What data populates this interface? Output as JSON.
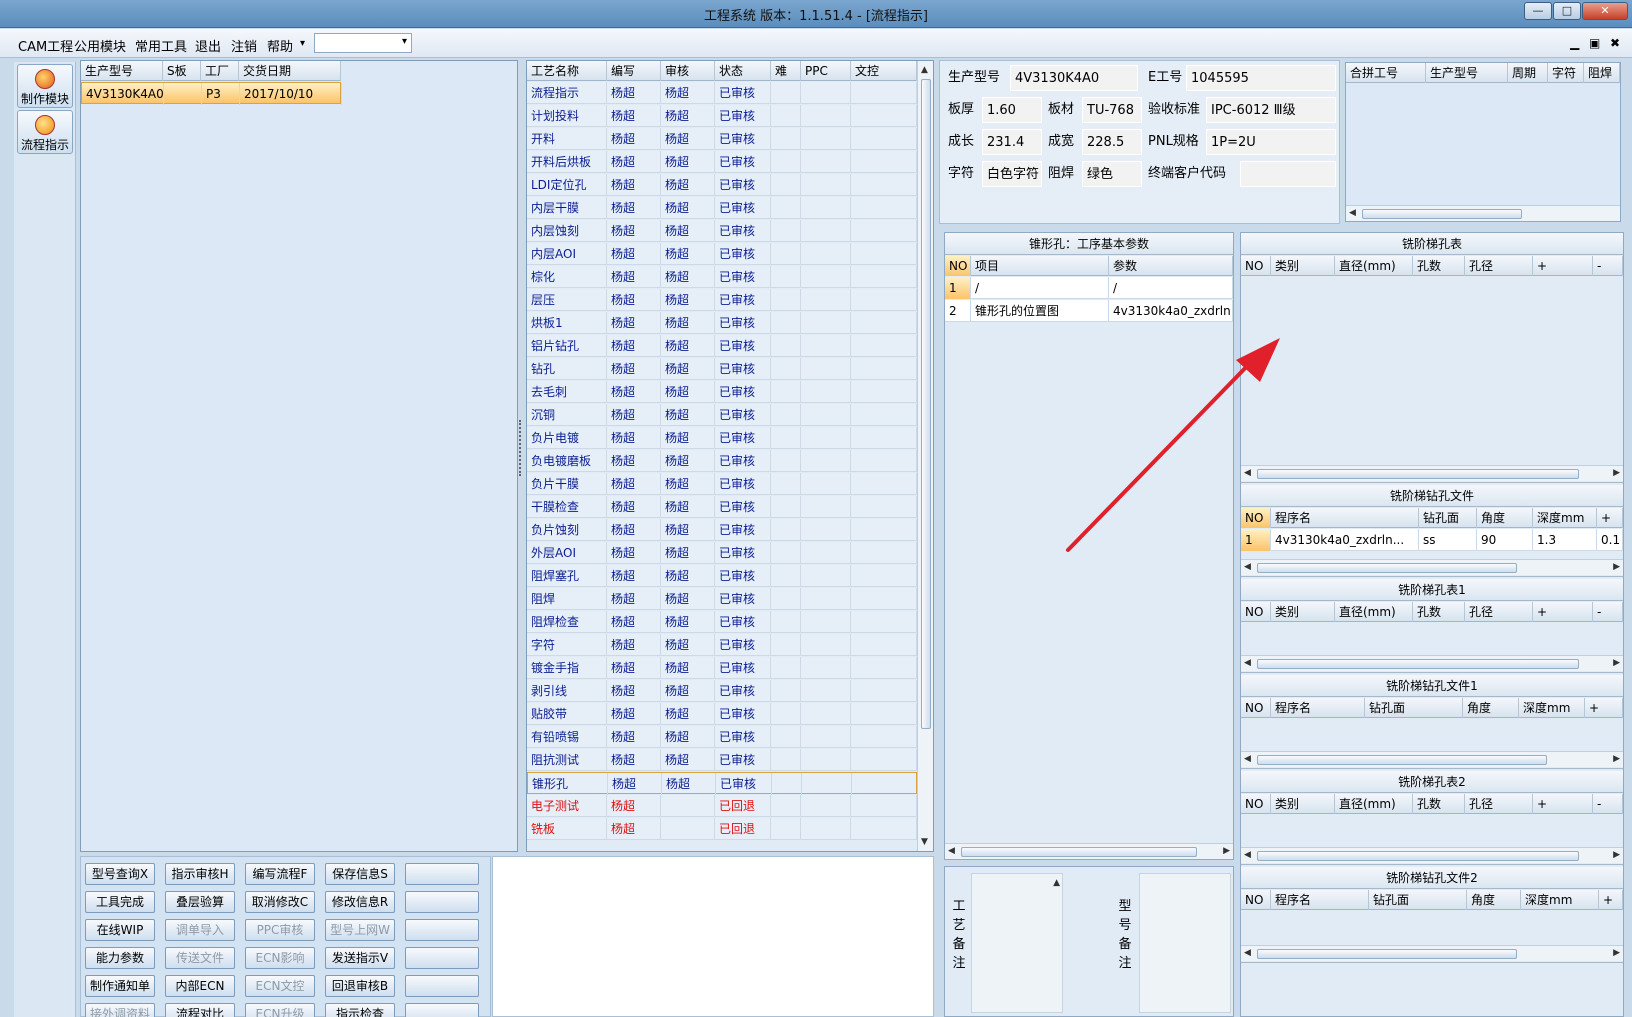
{
  "window": {
    "title": "工程系统   版本：1.1.51.4 - [流程指示]",
    "controls": {
      "minimize": "—",
      "maximize": "□",
      "close": "✕"
    }
  },
  "menu": {
    "items": [
      "CAM工程",
      "公用模块",
      "常用工具",
      "退出",
      "注销",
      "帮助"
    ],
    "dropdown_caret": "▾",
    "mdi": {
      "minimize": "▁",
      "restore": "▣",
      "close": "✖"
    }
  },
  "sidenav": {
    "items": [
      {
        "label": "制作模块",
        "icon": "flame-icon"
      },
      {
        "label": "流程指示",
        "icon": "pause-icon"
      }
    ]
  },
  "product_grid": {
    "headers": [
      "生产型号",
      "S板",
      "工厂",
      "交货日期"
    ],
    "rows": [
      [
        "4V3130K4A0",
        "",
        "P3",
        "2017/10/10"
      ]
    ]
  },
  "process_grid": {
    "headers": [
      "工艺名称",
      "编写",
      "审核",
      "状态",
      "难",
      "PPC",
      "文控"
    ],
    "rows": [
      [
        "流程指示",
        "杨超",
        "杨超",
        "已审核"
      ],
      [
        "计划投料",
        "杨超",
        "杨超",
        "已审核"
      ],
      [
        "开料",
        "杨超",
        "杨超",
        "已审核"
      ],
      [
        "开料后烘板",
        "杨超",
        "杨超",
        "已审核"
      ],
      [
        "LDI定位孔",
        "杨超",
        "杨超",
        "已审核"
      ],
      [
        "内层干膜",
        "杨超",
        "杨超",
        "已审核"
      ],
      [
        "内层蚀刻",
        "杨超",
        "杨超",
        "已审核"
      ],
      [
        "内层AOI",
        "杨超",
        "杨超",
        "已审核"
      ],
      [
        "棕化",
        "杨超",
        "杨超",
        "已审核"
      ],
      [
        "层压",
        "杨超",
        "杨超",
        "已审核"
      ],
      [
        "烘板1",
        "杨超",
        "杨超",
        "已审核"
      ],
      [
        "铝片钻孔",
        "杨超",
        "杨超",
        "已审核"
      ],
      [
        "钻孔",
        "杨超",
        "杨超",
        "已审核"
      ],
      [
        "去毛刺",
        "杨超",
        "杨超",
        "已审核"
      ],
      [
        "沉铜",
        "杨超",
        "杨超",
        "已审核"
      ],
      [
        "负片电镀",
        "杨超",
        "杨超",
        "已审核"
      ],
      [
        "负电镀磨板",
        "杨超",
        "杨超",
        "已审核"
      ],
      [
        "负片干膜",
        "杨超",
        "杨超",
        "已审核"
      ],
      [
        "干膜检查",
        "杨超",
        "杨超",
        "已审核"
      ],
      [
        "负片蚀刻",
        "杨超",
        "杨超",
        "已审核"
      ],
      [
        "外层AOI",
        "杨超",
        "杨超",
        "已审核"
      ],
      [
        "阻焊塞孔",
        "杨超",
        "杨超",
        "已审核"
      ],
      [
        "阻焊",
        "杨超",
        "杨超",
        "已审核"
      ],
      [
        "阻焊检查",
        "杨超",
        "杨超",
        "已审核"
      ],
      [
        "字符",
        "杨超",
        "杨超",
        "已审核"
      ],
      [
        "镀金手指",
        "杨超",
        "杨超",
        "已审核"
      ],
      [
        "剥引线",
        "杨超",
        "杨超",
        "已审核"
      ],
      [
        "贴胶带",
        "杨超",
        "杨超",
        "已审核"
      ],
      [
        "有铅喷锡",
        "杨超",
        "杨超",
        "已审核"
      ],
      [
        "阻抗测试",
        "杨超",
        "杨超",
        "已审核"
      ],
      [
        "锥形孔",
        "杨超",
        "杨超",
        "已审核"
      ],
      [
        "电子测试",
        "杨超",
        "",
        "已回退"
      ],
      [
        "铣板",
        "杨超",
        "",
        "已回退"
      ]
    ],
    "selected_row": 30,
    "rejected_rows": [
      31,
      32
    ]
  },
  "actions": [
    [
      "型号查询X",
      "指示审核H",
      "编写流程F",
      "保存信息S",
      ""
    ],
    [
      "工具完成",
      "叠层验算",
      "取消修改C",
      "修改信息R",
      ""
    ],
    [
      "在线WIP",
      "调单导入",
      "PPC审核",
      "型号上网W",
      ""
    ],
    [
      "能力参数",
      "传送文件",
      "ECN影响",
      "发送指示V",
      ""
    ],
    [
      "制作通知单",
      "内部ECN",
      "ECN文控",
      "回退审核B",
      ""
    ],
    [
      "接外调资料",
      "流程对比",
      "ECN升级",
      "指示检查",
      ""
    ]
  ],
  "info": {
    "labels": {
      "model": "生产型号",
      "e_no": "E工号",
      "thickness": "板厚",
      "material": "板材",
      "standard": "验收标准",
      "length": "成长",
      "width": "成宽",
      "pnl": "PNL规格",
      "char": "字符",
      "mask": "阻焊",
      "customer_code": "终端客户代码"
    },
    "values": {
      "model": "4V3130K4A0",
      "e_no": "1045595",
      "thickness": "1.60",
      "material": "TU-768",
      "standard": "IPC-6012 Ⅲ级",
      "length": "231.4",
      "width": "228.5",
      "pnl": "1P=2U",
      "char": "白色字符",
      "mask": "绿色",
      "customer_code": ""
    }
  },
  "merge_grid": {
    "headers": [
      "合拼工号",
      "生产型号",
      "周期",
      "字符",
      "阻焊"
    ]
  },
  "basic_params": {
    "title": "锥形孔：工序基本参数",
    "headers": [
      "NO",
      "项目",
      "参数"
    ],
    "rows": [
      [
        "1",
        "/",
        "/"
      ],
      [
        "2",
        "锥形孔的位置图",
        "4v3130k4a0_zxdrln"
      ]
    ]
  },
  "notes": {
    "process_label": "工艺备注",
    "model_label": "型号备注"
  },
  "step_tables": [
    {
      "title": "铣阶梯孔表",
      "headers": [
        "NO",
        "类别",
        "直径(mm)",
        "孔数",
        "孔径",
        "+",
        "-"
      ]
    },
    {
      "title": "铣阶梯钻孔文件",
      "headers": [
        "NO",
        "程序名",
        "钻孔面",
        "角度",
        "深度mm",
        "+"
      ],
      "rows": [
        [
          "1",
          "4v3130k4a0_zxdrln...",
          "ss",
          "90",
          "1.3",
          "0.1"
        ]
      ]
    },
    {
      "title": "铣阶梯孔表1",
      "headers": [
        "NO",
        "类别",
        "直径(mm)",
        "孔数",
        "孔径",
        "+",
        "-"
      ]
    },
    {
      "title": "铣阶梯钻孔文件1",
      "headers": [
        "NO",
        "程序名",
        "钻孔面",
        "角度",
        "深度mm",
        "+"
      ]
    },
    {
      "title": "铣阶梯孔表2",
      "headers": [
        "NO",
        "类别",
        "直径(mm)",
        "孔数",
        "孔径",
        "+",
        "-"
      ]
    },
    {
      "title": "铣阶梯钻孔文件2",
      "headers": [
        "NO",
        "程序名",
        "钻孔面",
        "角度",
        "深度mm",
        "+"
      ]
    }
  ],
  "annotation": {
    "arrow_color": "#e0202a"
  }
}
